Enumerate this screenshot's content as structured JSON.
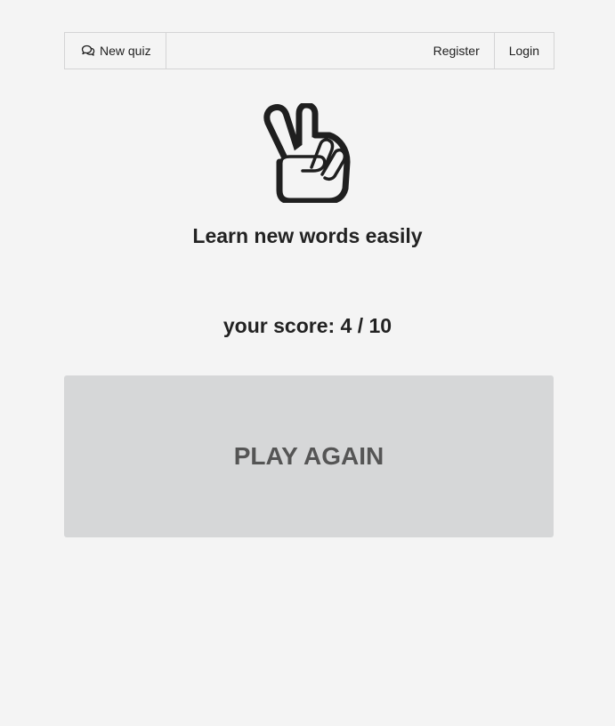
{
  "nav": {
    "new_quiz": {
      "label": "New quiz",
      "icon": "chat-bubbles-icon"
    },
    "register": "Register",
    "login": "Login"
  },
  "hero": {
    "logo_icon": "peace-hand-icon",
    "tagline": "Learn new words easily"
  },
  "result": {
    "score_text": "your score: 4 / 10",
    "score": 4,
    "total": 10
  },
  "actions": {
    "play_again": "PLAY AGAIN"
  },
  "colors": {
    "background": "#f4f4f4",
    "button_background": "#d6d7d8",
    "button_text": "#555555",
    "text": "#222222",
    "border": "#d4d4d5"
  }
}
